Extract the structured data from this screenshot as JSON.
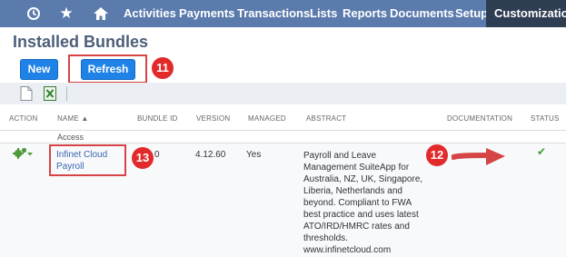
{
  "nav": {
    "items": [
      "Activities",
      "Payments",
      "Transactions",
      "Lists",
      "Reports",
      "Documents",
      "Setup",
      "Customization"
    ],
    "icons": [
      "history-icon",
      "star-icon",
      "home-icon"
    ]
  },
  "page": {
    "title": "Installed Bundles"
  },
  "buttons": {
    "new_label": "New",
    "refresh_label": "Refresh"
  },
  "callouts": {
    "refresh": "11",
    "status": "12",
    "name": "13"
  },
  "table": {
    "headers": [
      "ACTION",
      "NAME ▲",
      "BUNDLE ID",
      "VERSION",
      "MANAGED",
      "ABSTRACT",
      "DOCUMENTATION",
      "STATUS"
    ],
    "peek_text": "Access",
    "row": {
      "name": "Infinet Cloud Payroll",
      "bundle_id": "0",
      "version": "4.12.60",
      "managed": "Yes",
      "abstract": "Payroll and Leave Management SuiteApp for Australia, NZ, UK, Singapore, Liberia, Netherlands and beyond. Compliant to FWA best practice and uses latest ATO/IRD/HMRC rates and thresholds. www.infinetcloud.com",
      "status": "✔"
    }
  },
  "colors": {
    "nav_bg": "#5b7bad",
    "nav_active": "#2f3d52",
    "button": "#1e82e6",
    "callout": "#e22a2a",
    "check": "#3f9c35"
  }
}
